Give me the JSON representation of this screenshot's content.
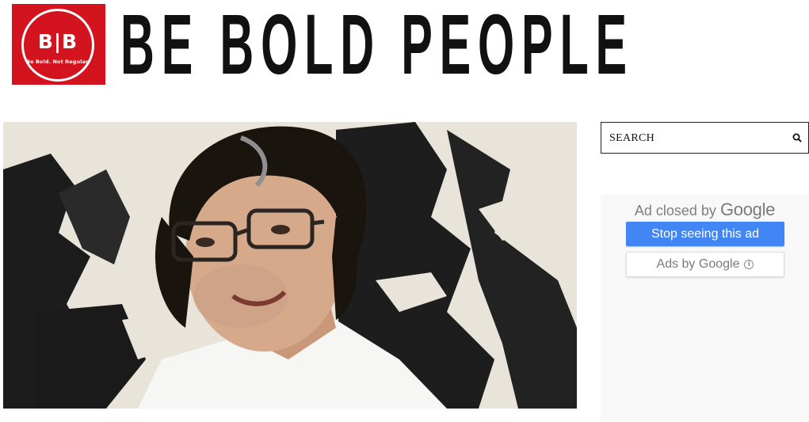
{
  "header": {
    "logo_mark": "B|B",
    "logo_tagline": "Be Bold. Not Regular.",
    "site_title": "BE BOLD PEOPLE",
    "brand_color": "#d3141f"
  },
  "featured": {
    "image": "portrait-photo"
  },
  "sidebar": {
    "search": {
      "placeholder": "SEARCH",
      "icon": "search-icon"
    },
    "ad": {
      "closed_prefix": "Ad closed by",
      "closed_brand": "Google",
      "stop_label": "Stop seeing this ad",
      "ads_by_label": "Ads by Google",
      "info_icon": "info-icon",
      "accent": "#4285f4"
    }
  }
}
